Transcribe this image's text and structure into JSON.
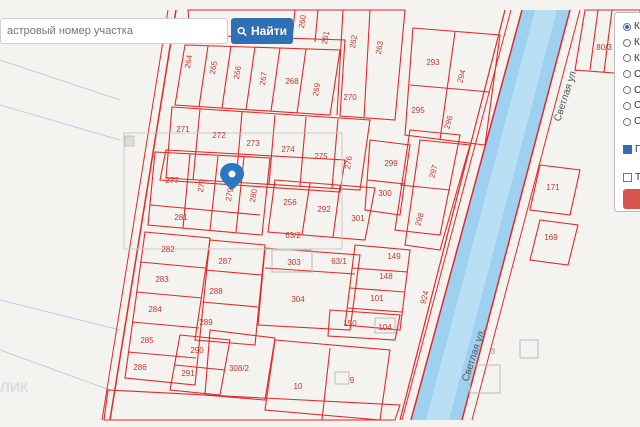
{
  "search": {
    "placeholder": "Кадастровый номер участка",
    "visible_placeholder": "астровый номер участка",
    "button_label": "Найти"
  },
  "map": {
    "parcels": [
      "264",
      "265",
      "266",
      "267",
      "268",
      "269",
      "270",
      "262",
      "261",
      "260",
      "263",
      "271",
      "272",
      "273",
      "274",
      "275",
      "276",
      "277",
      "278",
      "279",
      "280",
      "281",
      "256",
      "292",
      "301",
      "282",
      "287",
      "303",
      "63/2",
      "63/1",
      "149",
      "148",
      "101",
      "150",
      "104",
      "283",
      "284",
      "285",
      "286",
      "288",
      "289",
      "290",
      "291",
      "304",
      "308/2",
      "10",
      "9",
      "293",
      "294",
      "295",
      "296",
      "297",
      "298",
      "299",
      "300",
      "924",
      "80/3",
      "171",
      "169",
      "3"
    ],
    "street_labels": [
      "Светлая ул.",
      "Светлая ул."
    ],
    "label_fragments": [
      "ЛИК"
    ]
  },
  "layers": {
    "options": [
      "К",
      "К",
      "К",
      "С",
      "С",
      "С",
      "С"
    ],
    "selected_index": 0,
    "checkbox_1_label": "П",
    "checkbox_2_label": "Т"
  },
  "colors": {
    "boundary": "#e02a2a",
    "parcel_text": "#c0392b",
    "canal": "#9ed0ef",
    "accent": "#2f6fb5",
    "marker": "#2a78bf"
  }
}
